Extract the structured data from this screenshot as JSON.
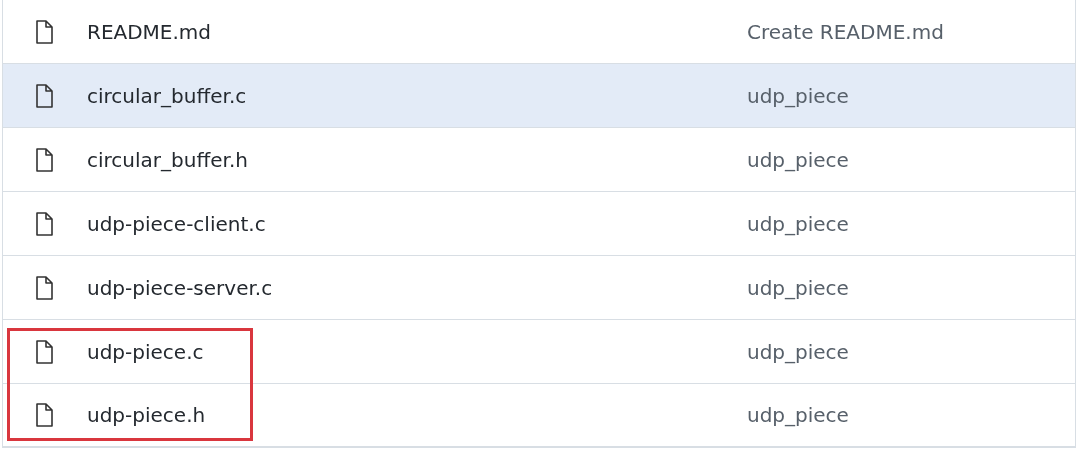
{
  "files": [
    {
      "name": "README.md",
      "message": "Create README.md",
      "hovered": false,
      "highlighted": false
    },
    {
      "name": "circular_buffer.c",
      "message": "udp_piece",
      "hovered": true,
      "highlighted": false
    },
    {
      "name": "circular_buffer.h",
      "message": "udp_piece",
      "hovered": false,
      "highlighted": false
    },
    {
      "name": "udp-piece-client.c",
      "message": "udp_piece",
      "hovered": false,
      "highlighted": false
    },
    {
      "name": "udp-piece-server.c",
      "message": "udp_piece",
      "hovered": false,
      "highlighted": false
    },
    {
      "name": "udp-piece.c",
      "message": "udp_piece",
      "hovered": false,
      "highlighted": true
    },
    {
      "name": "udp-piece.h",
      "message": "udp_piece",
      "hovered": false,
      "highlighted": true
    }
  ]
}
